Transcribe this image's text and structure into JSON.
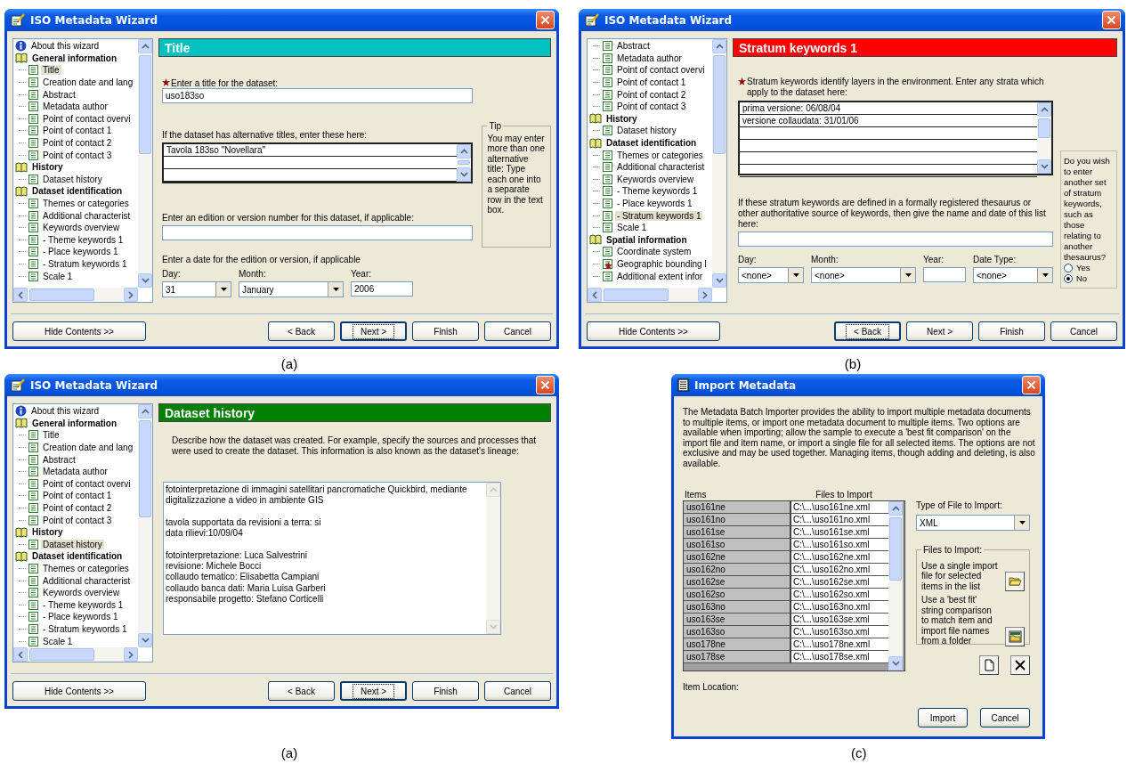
{
  "panels": [
    {
      "kind": "wizard",
      "caption": "(a)",
      "window": {
        "title": "ISO Metadata Wizard"
      },
      "tree": [
        {
          "kind": "info",
          "label": "About this wizard",
          "selected": false
        },
        {
          "kind": "section",
          "label": "General information",
          "selected": false,
          "children": [
            {
              "label": "Title",
              "selected": true
            },
            {
              "label": "Creation date and lang",
              "selected": false
            },
            {
              "label": "Abstract",
              "selected": false
            },
            {
              "label": "Metadata author",
              "selected": false
            },
            {
              "label": "Point of contact overvi",
              "selected": false
            },
            {
              "label": "Point of contact 1",
              "selected": false
            },
            {
              "label": "Point of contact 2",
              "selected": false
            },
            {
              "label": "Point of contact 3",
              "selected": false
            }
          ]
        },
        {
          "kind": "section",
          "label": "History",
          "selected": false,
          "children": [
            {
              "label": "Dataset history",
              "selected": false
            }
          ]
        },
        {
          "kind": "section",
          "label": "Dataset identification",
          "selected": false,
          "children": [
            {
              "label": "Themes or categories",
              "selected": false
            },
            {
              "label": "Additional characterist",
              "selected": false
            },
            {
              "label": "Keywords overview",
              "selected": false
            },
            {
              "label": "- Theme keywords 1",
              "selected": false
            },
            {
              "label": "- Place keywords 1",
              "selected": false
            },
            {
              "label": "- Stratum keywords 1",
              "selected": false
            },
            {
              "label": "Scale 1",
              "selected": false
            }
          ]
        }
      ],
      "page": {
        "kind": "title",
        "heading": "Title",
        "color": "#00c0c0",
        "title_label": "Enter a title for the dataset:",
        "title_value": "uso183so",
        "alt_label": "If the dataset has alternative titles, enter these here:",
        "alt_rows": [
          "Tavola 183so  \"Novellara\""
        ],
        "tip": {
          "label": "Tip",
          "text": "You may enter more than one alternative title:  Type each one into a separate row in the text box."
        },
        "edition_label": "Enter an edition or version number for this dataset, if applicable:",
        "date_label": "Enter a date for the edition or version, if applicable",
        "day": {
          "label": "Day:",
          "value": "31"
        },
        "month": {
          "label": "Month:",
          "value": "January"
        },
        "year": {
          "label": "Year:",
          "value": "2006"
        }
      },
      "hide_button": "Hide Contents >>",
      "buttons": [
        {
          "label": "< Back",
          "focused": false
        },
        {
          "label": "Next >",
          "focused": true
        },
        {
          "label": "Finish",
          "focused": false
        },
        {
          "label": "Cancel",
          "focused": false
        }
      ]
    },
    {
      "kind": "wizard",
      "caption": "(b)",
      "window": {
        "title": "ISO Metadata Wizard"
      },
      "tree": [
        {
          "kind": "page",
          "label": "Abstract",
          "selected": false
        },
        {
          "kind": "page",
          "label": "Metadata author",
          "selected": false
        },
        {
          "kind": "page",
          "label": "Point of contact overvi",
          "selected": false
        },
        {
          "kind": "page",
          "label": "Point of contact 1",
          "selected": false
        },
        {
          "kind": "page",
          "label": "Point of contact 2",
          "selected": false
        },
        {
          "kind": "page",
          "label": "Point of contact 3",
          "selected": false
        },
        {
          "kind": "section",
          "label": "History",
          "selected": false,
          "children": [
            {
              "label": "Dataset history",
              "selected": false
            }
          ]
        },
        {
          "kind": "section",
          "label": "Dataset identification",
          "selected": false,
          "children": [
            {
              "label": "Themes or categories",
              "selected": false
            },
            {
              "label": "Additional characterist",
              "selected": false
            },
            {
              "label": "Keywords overview",
              "selected": false
            },
            {
              "label": "- Theme keywords 1",
              "selected": false
            },
            {
              "label": "- Place keywords 1",
              "selected": false
            },
            {
              "label": "- Stratum keywords 1",
              "selected": true
            },
            {
              "label": "Scale 1",
              "selected": false
            }
          ]
        },
        {
          "kind": "section",
          "label": "Spatial information",
          "selected": false,
          "children": [
            {
              "label": "Coordinate system",
              "selected": false,
              "starred": false
            },
            {
              "label": "Geographic bounding l",
              "selected": false,
              "starred": true
            },
            {
              "label": "Additional extent infor",
              "selected": false,
              "starred": false
            }
          ]
        }
      ],
      "page": {
        "kind": "stratum",
        "heading": "Stratum keywords 1",
        "color": "#ff0000",
        "intro": "Stratum keywords identify layers in the environment.  Enter any strata which apply to the dataset here:",
        "rows": [
          "prima versione: 06/08/04",
          "versione collaudata: 31/01/06"
        ],
        "source_label": "If these stratum keywords are defined in a formally registered thesaurus or other authoritative source of keywords, then give the name and date of this list here:",
        "day": {
          "label": "Day:",
          "value": "<none>"
        },
        "month": {
          "label": "Month:",
          "value": "<none>"
        },
        "year": {
          "label": "Year:"
        },
        "date_type": {
          "label": "Date Type:",
          "value": "<none>"
        },
        "question": "Do you wish to enter another set of stratum keywords, such as those relating to another thesaurus?",
        "options": [
          {
            "label": "Yes",
            "selected": false
          },
          {
            "label": "No",
            "selected": true
          }
        ]
      },
      "hide_button": "Hide Contents >>",
      "buttons": [
        {
          "label": "< Back",
          "focused": true
        },
        {
          "label": "Next >",
          "focused": false
        },
        {
          "label": "Finish",
          "focused": false
        },
        {
          "label": "Cancel",
          "focused": false
        }
      ]
    },
    {
      "kind": "wizard",
      "caption": "(a)",
      "window": {
        "title": "ISO Metadata Wizard"
      },
      "tree": [
        {
          "kind": "info",
          "label": "About this wizard",
          "selected": false
        },
        {
          "kind": "section",
          "label": "General information",
          "selected": false,
          "children": [
            {
              "label": "Title",
              "selected": false
            },
            {
              "label": "Creation date and lang",
              "selected": false
            },
            {
              "label": "Abstract",
              "selected": false
            },
            {
              "label": "Metadata author",
              "selected": false
            },
            {
              "label": "Point of contact overvi",
              "selected": false
            },
            {
              "label": "Point of contact 1",
              "selected": false
            },
            {
              "label": "Point of contact 2",
              "selected": false
            },
            {
              "label": "Point of contact 3",
              "selected": false
            }
          ]
        },
        {
          "kind": "section",
          "label": "History",
          "selected": false,
          "children": [
            {
              "label": "Dataset history",
              "selected": true
            }
          ]
        },
        {
          "kind": "section",
          "label": "Dataset identification",
          "selected": false,
          "children": [
            {
              "label": "Themes or categories",
              "selected": false
            },
            {
              "label": "Additional characterist",
              "selected": false
            },
            {
              "label": "Keywords overview",
              "selected": false
            },
            {
              "label": "- Theme keywords 1",
              "selected": false
            },
            {
              "label": "- Place keywords 1",
              "selected": false
            },
            {
              "label": "- Stratum keywords 1",
              "selected": false
            },
            {
              "label": "Scale 1",
              "selected": false
            }
          ]
        }
      ],
      "page": {
        "kind": "history",
        "heading": "Dataset history",
        "color": "#008000",
        "intro": "Describe how the dataset was created.  For example, specify the sources and processes that were used to create the dataset.  This information is also known as the dataset's lineage:",
        "paragraphs": [
          [
            "fotointerpretazione di immagini satellitari pancromatiche Quickbird, mediante",
            "digitalizzazione a video in ambiente GIS"
          ],
          [
            "tavola supportata da revisioni a terra: si",
            "data rilievi:10/09/04"
          ],
          [
            "fotointerpretazione: Luca Salvestrini",
            "revisione: Michele Bocci",
            "collaudo tematico: Elisabetta Campiani",
            "collaudo banca dati: Maria Luisa Garberi",
            "responsabile progetto: Stefano Corticelli"
          ]
        ]
      },
      "hide_button": "Hide Contents >>",
      "buttons": [
        {
          "label": "< Back",
          "focused": false
        },
        {
          "label": "Next >",
          "focused": true
        },
        {
          "label": "Finish",
          "focused": false
        },
        {
          "label": "Cancel",
          "focused": false
        }
      ]
    },
    {
      "kind": "dialog",
      "caption": "(c)",
      "window": {
        "title": "Import Metadata"
      },
      "intro": "The Metadata Batch Importer provides the ability to import multiple metadata documents to multiple items, or import one metadata document to multiple items.  Two options are available when importing; allow the sample to execute a 'best fit comparison' on the import file and item name, or import a single file for all selected items.  The options are not exclusive and may be used together. Managing items, though adding and deleting, is also available.",
      "table": {
        "columns": [
          "Items",
          "Files to Import"
        ],
        "rows": [
          [
            "uso161ne",
            "C:\\...\\uso161ne.xml"
          ],
          [
            "uso161no",
            "C:\\...\\uso161no.xml"
          ],
          [
            "uso161se",
            "C:\\...\\uso161se.xml"
          ],
          [
            "uso161so",
            "C:\\...\\uso161so.xml"
          ],
          [
            "uso162ne",
            "C:\\...\\uso162ne.xml"
          ],
          [
            "uso162no",
            "C:\\...\\uso162no.xml"
          ],
          [
            "uso162se",
            "C:\\...\\uso162se.xml"
          ],
          [
            "uso162so",
            "C:\\...\\uso162so.xml"
          ],
          [
            "uso163no",
            "C:\\...\\uso163no.xml"
          ],
          [
            "uso163se",
            "C:\\...\\uso163se.xml"
          ],
          [
            "uso163so",
            "C:\\...\\uso163so.xml"
          ],
          [
            "uso178ne",
            "C:\\...\\uso178ne.xml"
          ],
          [
            "uso178se",
            "C:\\...\\uso178se.xml"
          ]
        ]
      },
      "type_label": "Type of File to Import:",
      "type_value": "XML",
      "group": {
        "label": "Files to Import:",
        "single_text": "Use a single import file for selected items in the list",
        "best_fit_text": "Use a 'best fit' string comparison to match item and import file names from a folder"
      },
      "location_label": "Item Location:",
      "buttons": [
        "Import",
        "Cancel"
      ]
    }
  ]
}
